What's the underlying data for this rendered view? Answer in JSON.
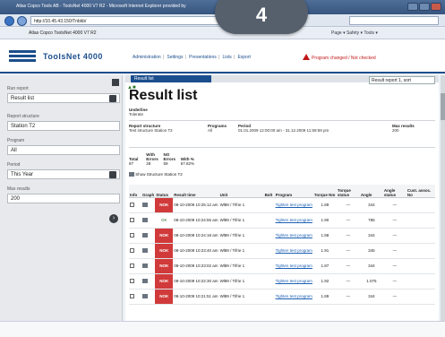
{
  "browser": {
    "window_title": "Atlas Copco Tools AB - ToolsNet 4000 V7 R2 - Microsoft Internet Explorer provided by",
    "url": "http://10.45.43.150/Tnbkb/",
    "favorite": "Atlas Copco ToolsNet 4000 V7 R2",
    "tools_text": "Page ▾  Safety ▾  Tools ▾"
  },
  "step_badge": "4",
  "app": {
    "logo_text": "ToolsNet 4000",
    "nav": [
      "Administration",
      "Settings",
      "Presentations",
      "Lists",
      "Export"
    ],
    "program_warning": "Program changed / Not checked"
  },
  "sidebar": {
    "run_report_label": "Run report",
    "report_value": "Result list",
    "structure_label": "Report structure",
    "structure_value": "Station T2",
    "program_label": "Program",
    "program_value": "All",
    "period_label": "Period",
    "period_value": "This Year",
    "max_results_label": "Max results",
    "max_results_value": "200"
  },
  "main": {
    "tab_label": "Result list",
    "view_select": "Result report 1, sort",
    "title": "Result list",
    "subtitle_label": "Underline",
    "subtitle_value": "Tolerate",
    "meta": {
      "structure_label": "Report structure",
      "structure_value": "Test structure Station T2",
      "programs_label": "Programs",
      "programs_value": "All",
      "period_label": "Period",
      "period_value": "01.01.2009 12:00:00 am - 31.12.2009 11:59:59 pm",
      "maxres_label": "Max results",
      "maxres_value": "200"
    },
    "stats": {
      "headers": [
        "Total",
        "With Errors",
        "NO Errors",
        "With %"
      ],
      "values": [
        "87",
        "28",
        "59",
        "67.82%"
      ]
    },
    "export_text": "Show Structure Station T2",
    "table": {
      "headers": [
        "Info",
        "Graph",
        "Status",
        "Result time",
        "Unit",
        "Bolt",
        "Program",
        "Torque Nm",
        "Torque status",
        "Angle",
        "Angle status",
        "Cust. assoc. No"
      ],
      "rows": [
        {
          "status": "NOK",
          "time": "08-10-2009 10:25:12 am",
          "unit": "Wl89 / Tifrie 1",
          "program": "Tighten test program",
          "torque": "1.89",
          "tstat": "—",
          "angle": "344",
          "astat": "—"
        },
        {
          "status": "OK",
          "time": "08-10-2009 10:24:55 am",
          "unit": "Wl89 / Tifrie 1",
          "program": "Tighten test program",
          "torque": "1.90",
          "tstat": "—",
          "angle": "785",
          "astat": "—"
        },
        {
          "status": "NOK",
          "time": "08-10-2009 10:24:18 am",
          "unit": "Wl89 / Tifrie 1",
          "program": "Tighten test program",
          "torque": "1.88",
          "tstat": "—",
          "angle": "344",
          "astat": "—"
        },
        {
          "status": "NOK",
          "time": "08-10-2009 10:23:40 am",
          "unit": "Wl89 / Tifrie 1",
          "program": "Tighten test program",
          "torque": "1.91",
          "tstat": "—",
          "angle": "345",
          "astat": "—"
        },
        {
          "status": "NOK",
          "time": "08-10-2009 10:23:02 am",
          "unit": "Wl89 / Tifrie 1",
          "program": "Tighten test program",
          "torque": "1.87",
          "tstat": "—",
          "angle": "344",
          "astat": "—"
        },
        {
          "status": "NOK",
          "time": "08-10-2009 10:22:30 am",
          "unit": "Wl89 / Tifrie 1",
          "program": "Tighten test program",
          "torque": "1.92",
          "tstat": "—",
          "angle": "1.075",
          "astat": "—"
        },
        {
          "status": "NOK",
          "time": "08-10-2009 10:21:51 am",
          "unit": "Wl89 / Tifrie 1",
          "program": "Tighten test program",
          "torque": "1.89",
          "tstat": "—",
          "angle": "344",
          "astat": "—"
        }
      ]
    }
  }
}
